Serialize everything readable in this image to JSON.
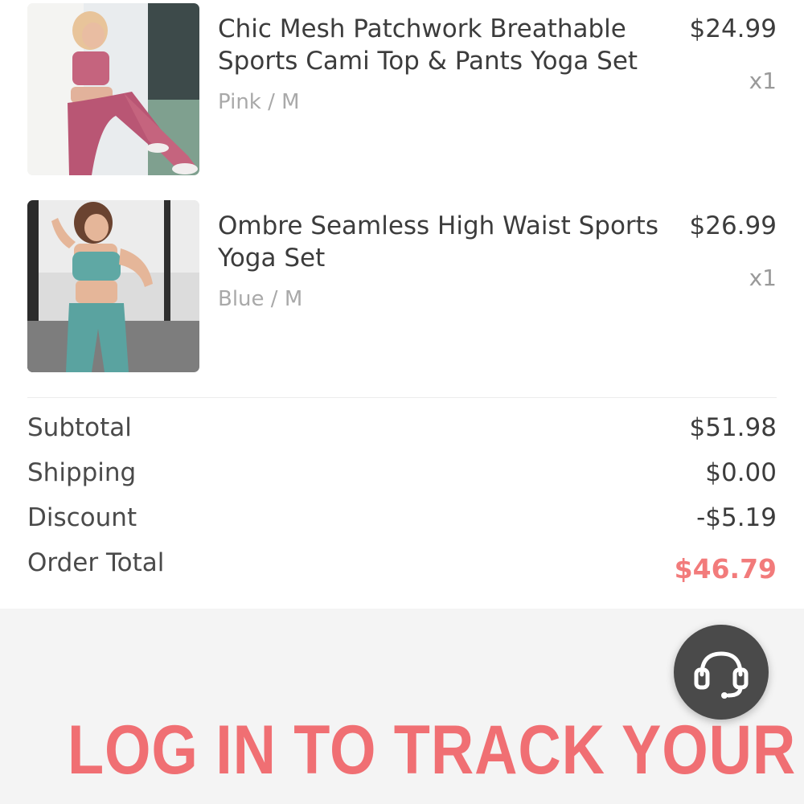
{
  "cart": {
    "items": [
      {
        "name": "Chic Mesh Patchwork Breathable Sports Cami Top & Pants Yoga Set",
        "variant": "Pink / M",
        "price": "$24.99",
        "quantity": "x1",
        "image_color": "#c5647e"
      },
      {
        "name": "Ombre Seamless High Waist Sports Yoga Set",
        "variant": "Blue / M",
        "price": "$26.99",
        "quantity": "x1",
        "image_color": "#5fa8a4"
      }
    ]
  },
  "summary": {
    "subtotal_label": "Subtotal",
    "subtotal_value": "$51.98",
    "shipping_label": "Shipping",
    "shipping_value": "$0.00",
    "discount_label": "Discount",
    "discount_value": "-$5.19",
    "total_label": "Order Total",
    "total_value": "$46.79"
  },
  "banner": {
    "text": "LOG IN TO TRACK YOUR"
  },
  "support": {
    "icon": "headset-icon"
  },
  "colors": {
    "accent": "#f06f73",
    "total_price": "#f27b7b",
    "fab_background": "#4a4a4a"
  }
}
